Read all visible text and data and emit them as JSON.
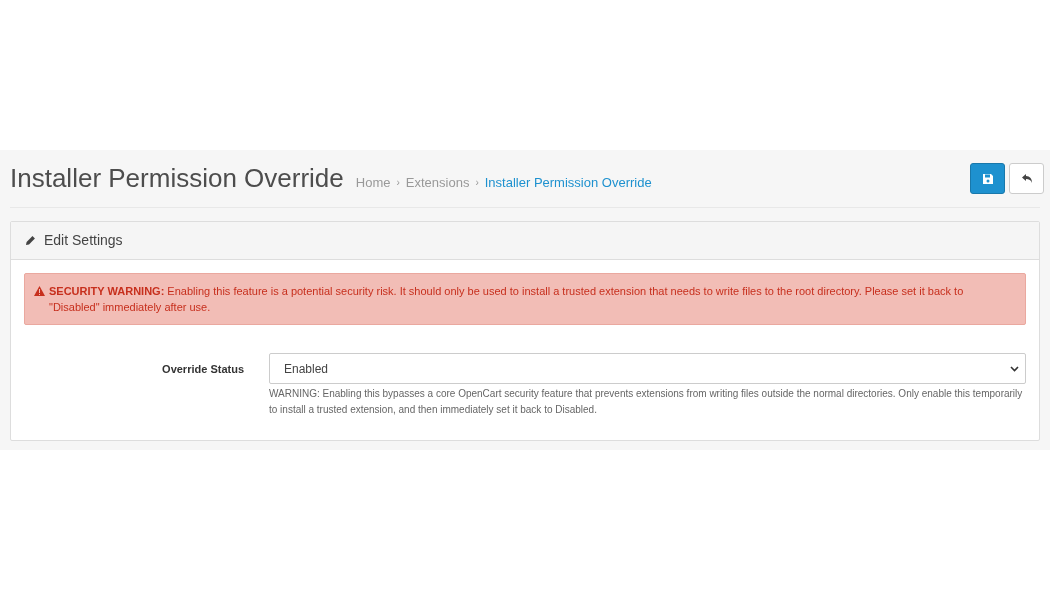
{
  "header": {
    "title": "Installer Permission Override",
    "breadcrumbs": [
      {
        "label": "Home",
        "current": false
      },
      {
        "separator": "›",
        "label": "Extensions",
        "current": false
      },
      {
        "separator": "›",
        "label": "Installer Permission Override",
        "current": true
      }
    ]
  },
  "panel": {
    "title": "Edit Settings",
    "alert": "**SECURITY WARNING:** Enabling this feature is a potential security risk. It should only be used to install a trusted extension that needs to write files to the root directory. Please set it back to \"Disabled\" immediately after use.",
    "field": {
      "label": "Override Status",
      "value": "Enabled",
      "help": "WARNING: Enabling this bypasses a core OpenCart security feature that prevents extensions from writing files outside the normal directories. Only enable this temporarily to install a trusted extension, and then immediately set it back to Disabled."
    }
  }
}
